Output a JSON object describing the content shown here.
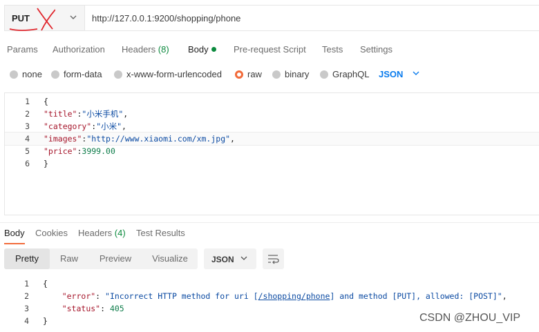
{
  "request": {
    "method": "PUT",
    "url": "http://127.0.0.1:9200/shopping/phone"
  },
  "request_tabs": [
    {
      "label": "Params"
    },
    {
      "label": "Authorization"
    },
    {
      "label": "Headers",
      "count": "(8)"
    },
    {
      "label": "Body"
    },
    {
      "label": "Pre-request Script"
    },
    {
      "label": "Tests"
    },
    {
      "label": "Settings"
    }
  ],
  "body_types": [
    "none",
    "form-data",
    "x-www-form-urlencoded",
    "raw",
    "binary",
    "GraphQL"
  ],
  "body_format": "JSON",
  "request_body_lines": [
    {
      "num": "1",
      "text": "{"
    },
    {
      "num": "2",
      "key": "\"title\"",
      "sep": ":",
      "val": "\"小米手机\"",
      "end": ","
    },
    {
      "num": "3",
      "key": "\"category\"",
      "sep": ":",
      "val": "\"小米\"",
      "end": ","
    },
    {
      "num": "4",
      "key": "\"images\"",
      "sep": ":",
      "val": "\"http://www.xiaomi.com/xm.jpg\"",
      "end": ","
    },
    {
      "num": "5",
      "key": "\"price\"",
      "sep": ":",
      "val": "3999.00",
      "end": ""
    },
    {
      "num": "6",
      "text": "}"
    }
  ],
  "response_tabs": [
    {
      "label": "Body"
    },
    {
      "label": "Cookies"
    },
    {
      "label": "Headers",
      "count": "(4)"
    },
    {
      "label": "Test Results"
    }
  ],
  "view_modes": [
    "Pretty",
    "Raw",
    "Preview",
    "Visualize"
  ],
  "response_format": "JSON",
  "response_lines": {
    "l1": {
      "num": "1",
      "text": "{"
    },
    "l2": {
      "num": "2",
      "key": "\"error\"",
      "pre": "\"Incorrect HTTP method for uri [",
      "link": "/shopping/phone",
      "post": "] and method [PUT], allowed: [POST]\"",
      "end": ","
    },
    "l3": {
      "num": "3",
      "key": "\"status\"",
      "val": "405"
    },
    "l4": {
      "num": "4",
      "text": "}"
    }
  },
  "watermark": "CSDN @ZHOU_VIP",
  "colors": {
    "accent": "#f26b3a",
    "link": "#097bed",
    "green": "#0c8a3e",
    "annotation": "#e0262d"
  }
}
